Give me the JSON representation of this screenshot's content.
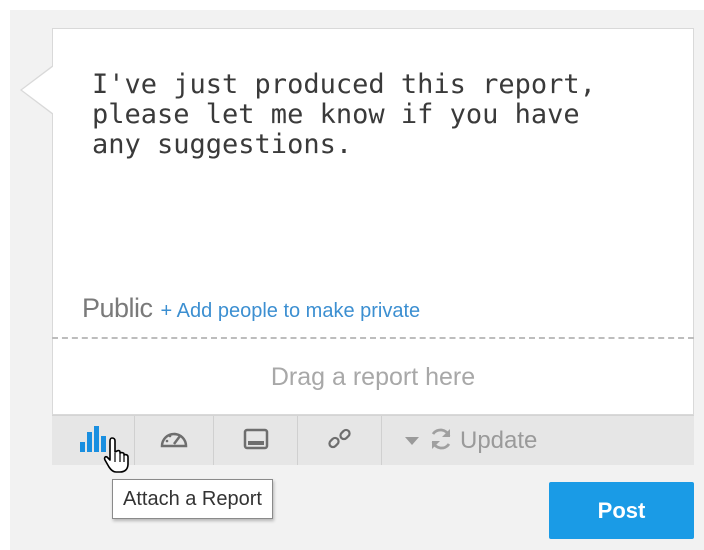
{
  "composer": {
    "message": "I've just produced this report,\nplease let me know if you have\nany suggestions.",
    "privacy_label": "Public",
    "privacy_link": "+ Add people to make private",
    "drop_zone_text": "Drag a report here"
  },
  "toolbar": {
    "update_label": "Update",
    "tools": [
      {
        "icon": "bar-chart-icon",
        "color": "#1a8fe0"
      },
      {
        "icon": "dashboard-gauge-icon",
        "color": "#6e6e6e"
      },
      {
        "icon": "storyboard-icon",
        "color": "#6e6e6e"
      },
      {
        "icon": "link-icon",
        "color": "#6e6e6e"
      },
      {
        "icon": "refresh-icon",
        "color": "#a0a0a0"
      }
    ]
  },
  "tooltip": {
    "text": "Attach a Report"
  },
  "actions": {
    "post_label": "Post",
    "post_color": "#1a9be6"
  }
}
